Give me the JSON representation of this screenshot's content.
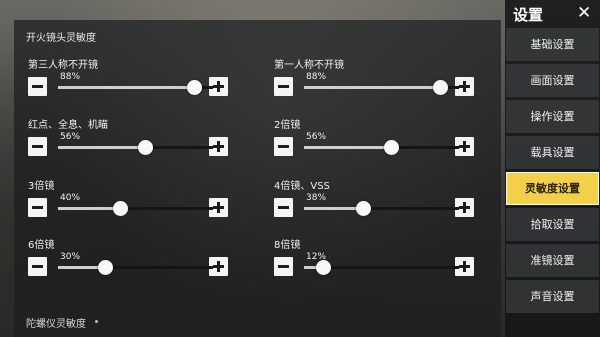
{
  "panel": {
    "title": "开火镜头灵敏度",
    "bottom_title": "陀螺仪灵敏度"
  },
  "sliders": [
    {
      "label": "第三人称不开镜",
      "pct_text": "88%",
      "value": 0.88,
      "col": 0,
      "row": 0
    },
    {
      "label": "第一人称不开镜",
      "pct_text": "88%",
      "value": 0.88,
      "col": 1,
      "row": 0
    },
    {
      "label": "红点、全息、机瞄",
      "pct_text": "56%",
      "value": 0.56,
      "col": 0,
      "row": 1
    },
    {
      "label": "2倍镜",
      "pct_text": "56%",
      "value": 0.56,
      "col": 1,
      "row": 1
    },
    {
      "label": "3倍镜",
      "pct_text": "40%",
      "value": 0.4,
      "col": 0,
      "row": 2
    },
    {
      "label": "4倍镜、VSS",
      "pct_text": "38%",
      "value": 0.38,
      "col": 1,
      "row": 2
    },
    {
      "label": "6倍镜",
      "pct_text": "30%",
      "value": 0.3,
      "col": 0,
      "row": 3
    },
    {
      "label": "8倍镜",
      "pct_text": "12%",
      "value": 0.12,
      "col": 1,
      "row": 3
    }
  ],
  "sidebar": {
    "title": "设置",
    "close": "✕",
    "active_index": 4,
    "items": [
      {
        "label": "基础设置"
      },
      {
        "label": "画面设置"
      },
      {
        "label": "操作设置"
      },
      {
        "label": "载具设置"
      },
      {
        "label": "灵敏度设置"
      },
      {
        "label": "拾取设置"
      },
      {
        "label": "准镜设置"
      },
      {
        "label": "声音设置"
      }
    ]
  },
  "colors": {
    "accent": "#f4d04a",
    "panel_bg": "#1c1e20",
    "button": "#f4f4f4"
  }
}
